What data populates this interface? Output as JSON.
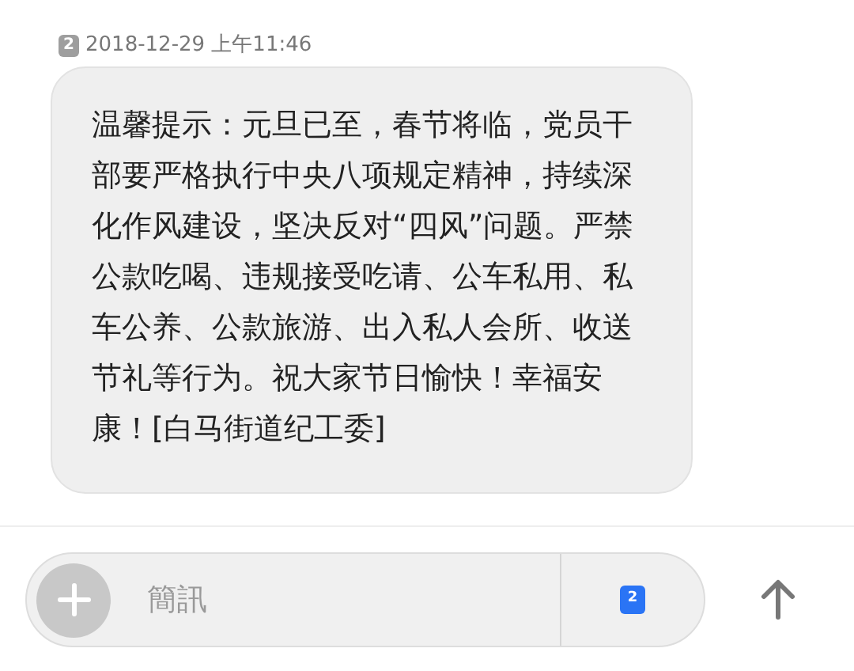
{
  "message": {
    "sim": "2",
    "timestamp": "2018-12-29 上午11:46",
    "text": "温馨提示：元旦已至，春节将临，党员干部要严格执行中央八项规定精神，持续深化作风建设，坚决反对“四风”问题。严禁公款吃喝、违规接受吃请、公车私用、私车公养、公款旅游、出入私人会所、收送节礼等行为。祝大家节日愉快！幸福安康！[白马街道纪工委]"
  },
  "composer": {
    "placeholder": "簡訊",
    "sim": "2"
  }
}
